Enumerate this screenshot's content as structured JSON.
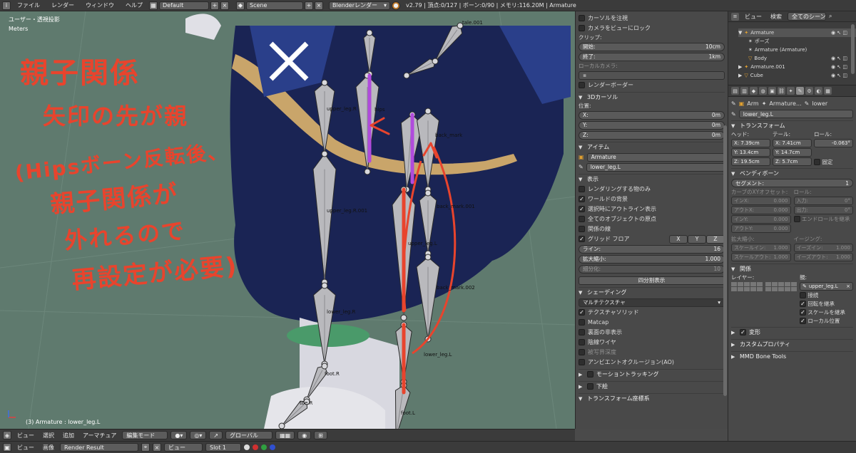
{
  "topbar": {
    "menus": [
      "ファイル",
      "レンダー",
      "ウィンドウ",
      "ヘルプ"
    ],
    "layout": "Default",
    "scene": "Scene",
    "renderer": "Blenderレンダー",
    "stats": "v2.79 | 頂点:0/127 | ボーン:0/90 | メモリ:116.20M | Armature"
  },
  "viewport": {
    "view_label": "ユーザー・透視投影",
    "units": "Meters",
    "status": "(3) Armature : lower_leg.L",
    "annotations": {
      "title": "親子関係",
      "line1": "矢印の先が親",
      "line2": "(Hipsボーン反転後、",
      "line3": "親子関係が",
      "line4": "外れるので",
      "line5": "再設定が必要)"
    },
    "bone_labels": [
      "upper_leg.R",
      "upper_leg.R.001",
      "lower_leg.R",
      "foot.R",
      "toe.R",
      "hips",
      "back_mark",
      "back_mark.001",
      "back_mark.002",
      "upper_leg.L",
      "lower_leg.L",
      "foot.L",
      "tale.001"
    ]
  },
  "vp_toolbar": {
    "menus": [
      "ビュー",
      "選択",
      "追加",
      "アーマチュア"
    ],
    "mode": "編集モード",
    "orientation": "グローバル"
  },
  "bottombar": {
    "menus": [
      "ビュー",
      "画像"
    ],
    "image": "Render Result",
    "view": "ビュー",
    "slot": "Slot 1"
  },
  "npanel": {
    "cursor_to_selected": "カーソルを注視",
    "lock_camera": "カメラをビューにロック",
    "clip_label": "クリップ:",
    "clip_start_label": "開始:",
    "clip_start": "10cm",
    "clip_end_label": "終了:",
    "clip_end": "1km",
    "local_camera": "ローカルカメラ:",
    "render_border": "レンダーボーダー",
    "cursor_header": "3Dカーソル",
    "position_label": "位置:",
    "cursor_x_label": "X:",
    "cursor_x": "0m",
    "cursor_y_label": "Y:",
    "cursor_y": "0m",
    "cursor_z_label": "Z:",
    "cursor_z": "0m",
    "item_header": "アイテム",
    "item_object": "Armature",
    "item_bone": "lower_leg.L",
    "display_header": "表示",
    "only_render": "レンダリングする物のみ",
    "world_bg": "ワールドの背景",
    "outline_selected": "選択時にアウトライン表示",
    "all_origins": "全てのオブジェクトの原点",
    "relation_lines": "関係の線",
    "grid_floor": "グリッド フロア",
    "axis_x": "X",
    "axis_y": "Y",
    "axis_z": "Z",
    "lines_label": "ライン:",
    "lines": "16",
    "scale_label": "拡大縮小:",
    "scale": "1.000",
    "subdiv_label": "細分化:",
    "subdiv": "10",
    "quad_view": "四分割表示",
    "shading_header": "シェーディング",
    "shading_mode": "マルチテクスチャ",
    "tex_solid": "テクスチャソリッド",
    "matcap": "Matcap",
    "backface": "裏面の非表示",
    "hidden_wire": "陰線ワイヤ",
    "dof": "被写界深度",
    "ao": "アンビエントオクルージョン(AO)",
    "motion_tracking": "モーショントラッキング",
    "background": "下絵",
    "transform_orient": "トランスフォーム座標系"
  },
  "outliner": {
    "view": "ビュー",
    "search": "検索",
    "scope": "全てのシーン",
    "rows": [
      "Armature",
      "ポーズ",
      "Armature (Armature)",
      "Body",
      "Armature.001",
      "Cube"
    ]
  },
  "props": {
    "breadcrumb": [
      "Arm",
      "Armature...",
      "lower"
    ],
    "bone_name": "lower_leg.L",
    "transform_header": "トランスフォーム",
    "head_label": "ヘッド:",
    "tail_label": "テール:",
    "roll_label": "ロール:",
    "head_x": "X: 7.39cm",
    "head_y": "Y: 13.4cm",
    "head_z": "Z: 19.5cm",
    "tail_x": "X: 7.41cm",
    "tail_y": "Y: 14.7cm",
    "tail_z": "Z: 5.7cm",
    "roll": "-0.063°",
    "lock": "固定",
    "bendy_header": "ベンディボーン",
    "segments_label": "セグメント:",
    "segments": "1",
    "curve_xy": "カーブのXYオフセット:",
    "roll2": "ロール:",
    "in_x": "インX:",
    "in_x_v": "0.000",
    "out_x": "アウトX:",
    "out_x_v": "0.000",
    "in_y": "インY:",
    "in_y_v": "0.000",
    "out_y": "アウトY:",
    "out_y_v": "0.000",
    "roll_in": "入力:",
    "roll_in_v": "0°",
    "roll_out": "出力:",
    "roll_out_v": "0°",
    "inherit_end_roll": "エンドロールを継承",
    "scale_label": "拡大縮小:",
    "ease_label": "イージング:",
    "scale_in": "スケールイン:",
    "scale_in_v": "1.000",
    "scale_out": "スケールアウト:",
    "scale_out_v": "1.000",
    "ease_in": "イーズイン:",
    "ease_in_v": "1.000",
    "ease_out": "イーズアウト:",
    "ease_out_v": "1.000",
    "relations_header": "関係",
    "layer_label": "レイヤー:",
    "parent_label": "親:",
    "parent": "upper_leg.L",
    "connected": "接続",
    "inherit_rot": "回転を継承",
    "inherit_scale": "スケールを継承",
    "local_location": "ローカル位置",
    "deform": "変形",
    "custom_props": "カスタムプロパティ",
    "mmd_tools": "MMD Bone Tools"
  },
  "colors": {
    "annotation_red": "#e8442d",
    "selected_bone": "#b04bdc",
    "viewport_bg": "#5f7a6e"
  }
}
